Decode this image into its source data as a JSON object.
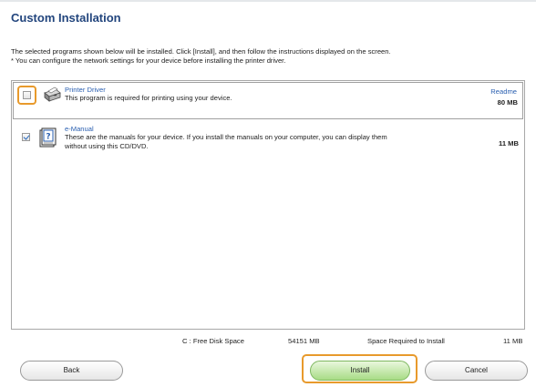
{
  "title": "Custom Installation",
  "description": {
    "line1": "The selected programs shown below will be installed. Click [Install], and then follow the instructions displayed on the screen.",
    "line2": "* You can configure the network settings for your device before installing the printer driver."
  },
  "programs": [
    {
      "name": "Printer Driver",
      "description": "This program is required for printing using your device.",
      "size": "80 MB",
      "readme": "Readme",
      "checked": false,
      "icon": "printer-icon"
    },
    {
      "name": "e-Manual",
      "description_line1": "These are the manuals for your device. If you install the manuals on your computer, you can display them",
      "description_line2": "without using this CD/DVD.",
      "size": "11 MB",
      "checked": true,
      "icon": "manual-book-icon"
    }
  ],
  "disk": {
    "free_label": "C : Free Disk Space",
    "free_value": "54151 MB",
    "required_label": "Space Required to Install",
    "required_value": "11 MB"
  },
  "buttons": {
    "back": "Back",
    "install": "Install",
    "cancel": "Cancel"
  },
  "colors": {
    "title": "#22457d",
    "link": "#2a5fb0",
    "highlight": "#e89a2c",
    "install_button": "#a8dc86"
  }
}
